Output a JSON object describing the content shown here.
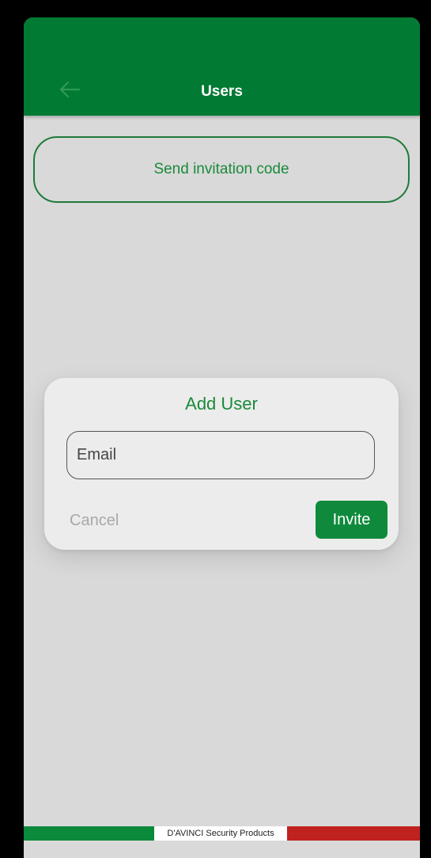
{
  "header": {
    "title": "Users",
    "back_icon": "arrow-left-icon",
    "background_color": "#017a33"
  },
  "main": {
    "send_invitation_label": "Send invitation code"
  },
  "dialog": {
    "title": "Add User",
    "email_placeholder": "Email",
    "cancel_label": "Cancel",
    "invite_label": "Invite"
  },
  "footer": {
    "brand_text": "D'AVINCI Security Products",
    "colors": {
      "green": "#0a8a3a",
      "white": "#ffffff",
      "red": "#c0221f"
    }
  }
}
